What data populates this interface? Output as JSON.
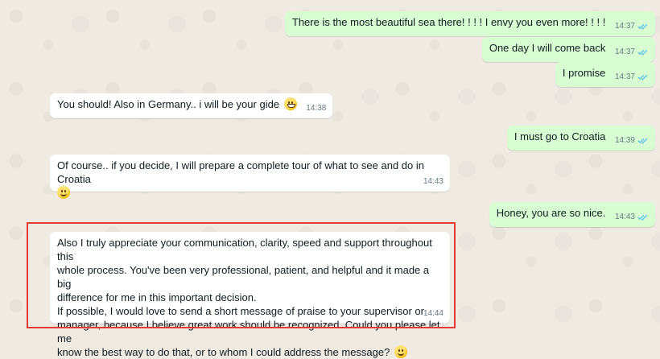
{
  "messages": [
    {
      "dir": "out",
      "text": "There is the most beautiful sea there! ! ! ! I envy you even more! ! ! !",
      "time": "14:37"
    },
    {
      "dir": "out",
      "text": "One day I will come back",
      "time": "14:37"
    },
    {
      "dir": "out",
      "text": "I promise",
      "time": "14:37"
    },
    {
      "dir": "in",
      "text": "You should! Also in Germany.. i will be your gide",
      "time": "14:38",
      "emoji": "grinning-face"
    },
    {
      "dir": "out",
      "text": "I must go to Croatia",
      "time": "14:39"
    },
    {
      "dir": "in",
      "text": "Of course.. if you decide, I will prepare a complete tour of what to see and do in Croatia",
      "time": "14:43",
      "emoji": "smiling-face"
    },
    {
      "dir": "out",
      "text": "Honey, you are so nice.",
      "time": "14:43"
    },
    {
      "dir": "in",
      "lines": [
        "Also I truly appreciate your communication, clarity, speed and support throughout this",
        "whole process. You've been very professional, patient, and helpful and it made a big",
        "difference for me in this important decision.",
        "If possible, I would love to send a short message of praise to your supervisor or",
        "manager, because I believe great work should be recognized. Could you please let me",
        "know the best way to do that, or to whom I could address the message?"
      ],
      "time": "14:44",
      "emoji": "smiling-face"
    }
  ],
  "colors": {
    "outgoing_bubble": "#d9fdd3",
    "incoming_bubble": "#ffffff",
    "read_ticks": "#53bdeb",
    "highlight_border": "#e53935",
    "chat_background": "#efeae2"
  }
}
